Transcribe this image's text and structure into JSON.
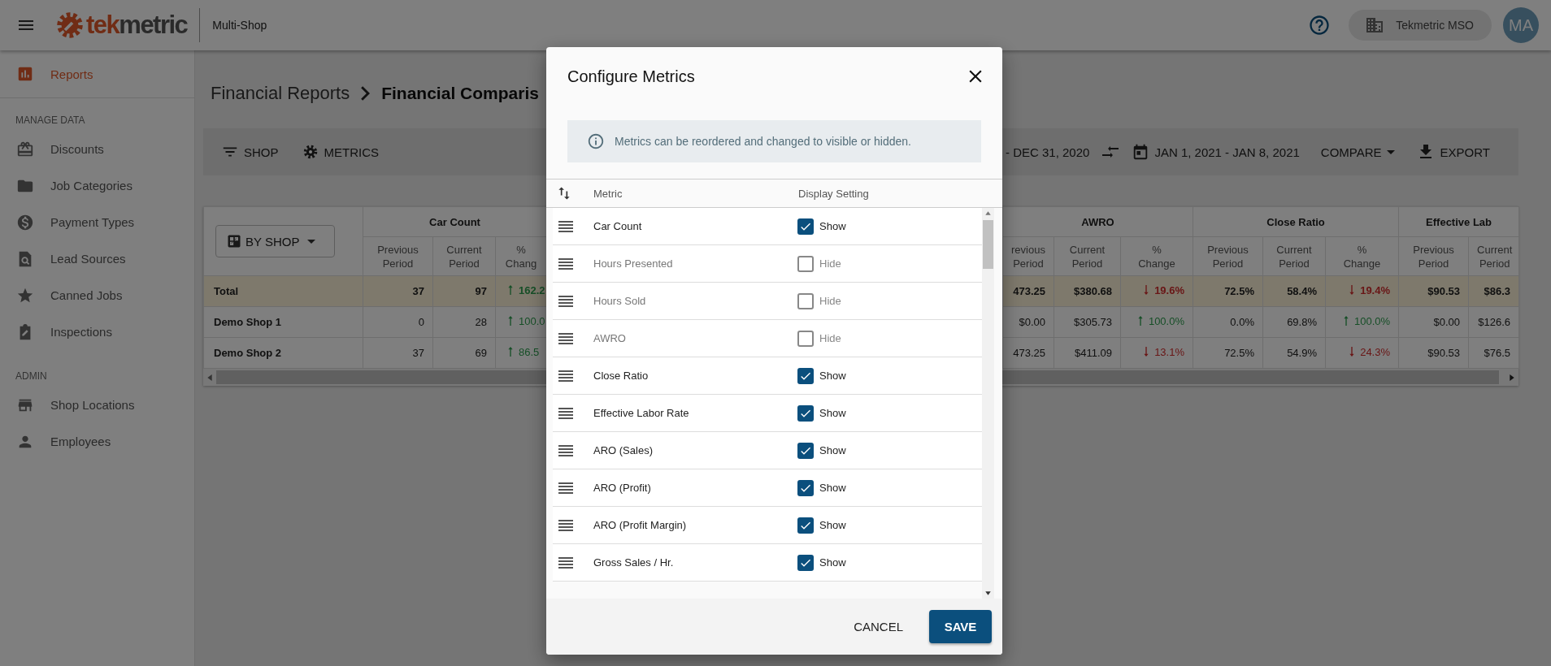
{
  "header": {
    "logo_parts": [
      "tek",
      "metric"
    ],
    "app_name": "Multi-Shop",
    "organization": "Tekmetric MSO",
    "avatar_initials": "MA"
  },
  "sidebar": {
    "top_item": {
      "label": "Reports",
      "selected": true
    },
    "sections": [
      {
        "label": "MANAGE DATA",
        "items": [
          {
            "label": "Discounts",
            "selected": false
          },
          {
            "label": "Job Categories",
            "selected": false
          },
          {
            "label": "Payment Types",
            "selected": false
          },
          {
            "label": "Lead Sources",
            "selected": false
          },
          {
            "label": "Canned Jobs",
            "selected": false
          },
          {
            "label": "Inspections",
            "selected": false
          }
        ]
      },
      {
        "label": "ADMIN",
        "items": [
          {
            "label": "Shop Locations",
            "selected": false
          },
          {
            "label": "Employees",
            "selected": false
          }
        ]
      }
    ]
  },
  "breadcrumb": [
    "Financial Reports",
    "Financial Comparis"
  ],
  "toolbar": {
    "left": [
      "SHOP",
      "METRICS"
    ],
    "previous_range": "- DEC 31, 2020",
    "current_range": "JAN 1, 2021 - JAN 8, 2021",
    "compare": "COMPARE",
    "export": "EXPORT"
  },
  "table": {
    "view_button": "BY SHOP",
    "left_groups": [
      {
        "label": "Car Count",
        "columns": [
          "Previous Period",
          "Current Period",
          "% Chang"
        ]
      }
    ],
    "right_groups": [
      {
        "label": "AWRO",
        "columns": [
          "revious Period",
          "Current Period",
          "% Change"
        ]
      },
      {
        "label": "Close Ratio",
        "columns": [
          "Previous Period",
          "Current Period",
          "% Change"
        ]
      },
      {
        "label": "Effective Lab",
        "columns": [
          "Previous Period",
          "Current Period"
        ]
      }
    ],
    "rows": [
      {
        "name": "Total",
        "highlighted": true,
        "left": [
          {
            "text": "37"
          },
          {
            "text": "97"
          },
          {
            "text": "162.2",
            "increase": true
          }
        ],
        "right": [
          {
            "text": "473.25"
          },
          {
            "text": "$380.68"
          },
          {
            "text": "19.6%",
            "increase": false
          },
          {
            "text": "72.5%"
          },
          {
            "text": "58.4%"
          },
          {
            "text": "19.4%",
            "increase": false
          },
          {
            "text": "$90.53"
          },
          {
            "text": "$86.3"
          }
        ]
      },
      {
        "name": "Demo Shop 1",
        "highlighted": false,
        "left": [
          {
            "text": "0"
          },
          {
            "text": "28"
          },
          {
            "text": "100.0",
            "increase": true
          }
        ],
        "right": [
          {
            "text": "$0.00"
          },
          {
            "text": "$305.73"
          },
          {
            "text": "100.0%",
            "increase": true
          },
          {
            "text": "0.0%"
          },
          {
            "text": "69.8%"
          },
          {
            "text": "100.0%",
            "increase": true
          },
          {
            "text": "$0.00"
          },
          {
            "text": "$126.6"
          }
        ]
      },
      {
        "name": "Demo Shop 2",
        "highlighted": false,
        "left": [
          {
            "text": "37"
          },
          {
            "text": "69"
          },
          {
            "text": "86.5",
            "increase": true
          }
        ],
        "right": [
          {
            "text": "473.25"
          },
          {
            "text": "$411.09"
          },
          {
            "text": "13.1%",
            "increase": false
          },
          {
            "text": "72.5%"
          },
          {
            "text": "54.9%"
          },
          {
            "text": "24.3%",
            "increase": false
          },
          {
            "text": "$90.53"
          },
          {
            "text": "$76.5"
          }
        ]
      }
    ]
  },
  "dialog": {
    "title": "Configure Metrics",
    "info": "Metrics can be reordered and changed to visible or hidden.",
    "columns": [
      "Metric",
      "Display Setting"
    ],
    "metrics": [
      {
        "name": "Car Count",
        "visible": true,
        "setting": "Show"
      },
      {
        "name": "Hours Presented",
        "visible": false,
        "setting": "Hide"
      },
      {
        "name": "Hours Sold",
        "visible": false,
        "setting": "Hide"
      },
      {
        "name": "AWRO",
        "visible": false,
        "setting": "Hide"
      },
      {
        "name": "Close Ratio",
        "visible": true,
        "setting": "Show"
      },
      {
        "name": "Effective Labor Rate",
        "visible": true,
        "setting": "Show"
      },
      {
        "name": "ARO (Sales)",
        "visible": true,
        "setting": "Show"
      },
      {
        "name": "ARO (Profit)",
        "visible": true,
        "setting": "Show"
      },
      {
        "name": "ARO (Profit Margin)",
        "visible": true,
        "setting": "Show"
      },
      {
        "name": "Gross Sales / Hr.",
        "visible": true,
        "setting": "Show"
      }
    ],
    "buttons": [
      "CANCEL",
      "SAVE"
    ]
  }
}
